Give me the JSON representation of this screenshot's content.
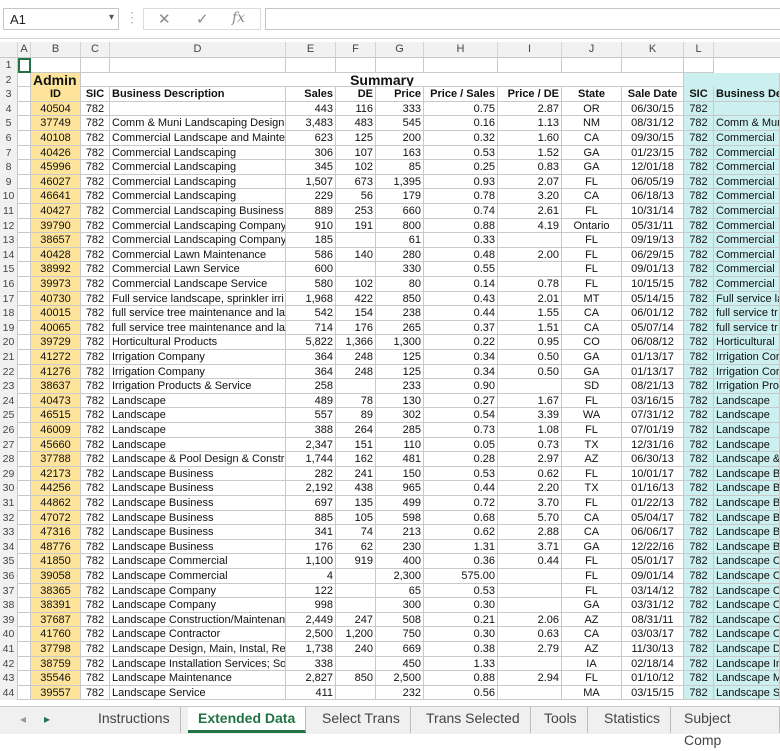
{
  "formula_bar": {
    "name_box": "A1",
    "fx": "fx",
    "cancel": "✕",
    "enter": "✓",
    "formula": ""
  },
  "columns": [
    "A",
    "B",
    "C",
    "D",
    "E",
    "F",
    "G",
    "H",
    "I",
    "J",
    "K",
    "L"
  ],
  "titles": {
    "admin": "Admin",
    "summary": "Summary"
  },
  "headers": [
    "ID",
    "SIC",
    "Business Description",
    "Sales",
    "DE",
    "Price",
    "Price / Sales",
    "Price / DE",
    "State",
    "Sale Date",
    "SIC",
    "Business De"
  ],
  "rows": [
    [
      "40504",
      "782",
      "",
      "443",
      "116",
      "333",
      "0.75",
      "2.87",
      "OR",
      "06/30/15",
      "782",
      ""
    ],
    [
      "37749",
      "782",
      "Comm & Muni Landscaping Design,",
      "3,483",
      "483",
      "545",
      "0.16",
      "1.13",
      "NM",
      "08/31/12",
      "782",
      "Comm & Mun"
    ],
    [
      "40108",
      "782",
      "Commercial Landscape and Mainte",
      "623",
      "125",
      "200",
      "0.32",
      "1.60",
      "CA",
      "09/30/15",
      "782",
      "Commercial"
    ],
    [
      "40426",
      "782",
      "Commercial Landscaping",
      "306",
      "107",
      "163",
      "0.53",
      "1.52",
      "GA",
      "01/23/15",
      "782",
      "Commercial"
    ],
    [
      "45996",
      "782",
      "Commercial Landscaping",
      "345",
      "102",
      "85",
      "0.25",
      "0.83",
      "GA",
      "12/01/18",
      "782",
      "Commercial"
    ],
    [
      "46027",
      "782",
      "Commercial Landscaping",
      "1,507",
      "673",
      "1,395",
      "0.93",
      "2.07",
      "FL",
      "06/05/19",
      "782",
      "Commercial"
    ],
    [
      "46641",
      "782",
      "Commercial Landscaping",
      "229",
      "56",
      "179",
      "0.78",
      "3.20",
      "CA",
      "06/18/13",
      "782",
      "Commercial"
    ],
    [
      "40427",
      "782",
      "Commercial Landscaping Business",
      "889",
      "253",
      "660",
      "0.74",
      "2.61",
      "FL",
      "10/31/14",
      "782",
      "Commercial"
    ],
    [
      "39790",
      "782",
      "Commercial Landscaping Company",
      "910",
      "191",
      "800",
      "0.88",
      "4.19",
      "Ontario",
      "05/31/11",
      "782",
      "Commercial"
    ],
    [
      "38657",
      "782",
      "Commercial Landscaping Company",
      "185",
      "",
      "61",
      "0.33",
      "",
      "FL",
      "09/19/13",
      "782",
      "Commercial"
    ],
    [
      "40428",
      "782",
      "Commercial Lawn Maintenance",
      "586",
      "140",
      "280",
      "0.48",
      "2.00",
      "FL",
      "06/29/15",
      "782",
      "Commercial"
    ],
    [
      "38992",
      "782",
      "Commercial Lawn Service",
      "600",
      "",
      "330",
      "0.55",
      "",
      "FL",
      "09/01/13",
      "782",
      "Commercial"
    ],
    [
      "39973",
      "782",
      "Commercial Landscape Service",
      "580",
      "102",
      "80",
      "0.14",
      "0.78",
      "FL",
      "10/15/15",
      "782",
      "Commercial"
    ],
    [
      "40730",
      "782",
      "Full service landscape, sprinkler irri",
      "1,968",
      "422",
      "850",
      "0.43",
      "2.01",
      "MT",
      "05/14/15",
      "782",
      "Full service la"
    ],
    [
      "40015",
      "782",
      "full service tree maintenance and la",
      "542",
      "154",
      "238",
      "0.44",
      "1.55",
      "CA",
      "06/01/12",
      "782",
      "full service tr"
    ],
    [
      "40065",
      "782",
      "full service tree maintenance and la",
      "714",
      "176",
      "265",
      "0.37",
      "1.51",
      "CA",
      "05/07/14",
      "782",
      "full service tr"
    ],
    [
      "39729",
      "782",
      "Horticultural Products",
      "5,822",
      "1,366",
      "1,300",
      "0.22",
      "0.95",
      "CO",
      "06/08/12",
      "782",
      "Horticultural"
    ],
    [
      "41272",
      "782",
      "Irrigation Company",
      "364",
      "248",
      "125",
      "0.34",
      "0.50",
      "GA",
      "01/13/17",
      "782",
      "Irrigation Cor"
    ],
    [
      "41276",
      "782",
      "Irrigation Company",
      "364",
      "248",
      "125",
      "0.34",
      "0.50",
      "GA",
      "01/13/17",
      "782",
      "Irrigation Cor"
    ],
    [
      "38637",
      "782",
      "Irrigation Products & Service",
      "258",
      "",
      "233",
      "0.90",
      "",
      "SD",
      "08/21/13",
      "782",
      "Irrigation Pro"
    ],
    [
      "40473",
      "782",
      "Landscape",
      "489",
      "78",
      "130",
      "0.27",
      "1.67",
      "FL",
      "03/16/15",
      "782",
      "Landscape"
    ],
    [
      "46515",
      "782",
      "Landscape",
      "557",
      "89",
      "302",
      "0.54",
      "3.39",
      "WA",
      "07/31/12",
      "782",
      "Landscape"
    ],
    [
      "46009",
      "782",
      "Landscape",
      "388",
      "264",
      "285",
      "0.73",
      "1.08",
      "FL",
      "07/01/19",
      "782",
      "Landscape"
    ],
    [
      "45660",
      "782",
      "Landscape",
      "2,347",
      "151",
      "110",
      "0.05",
      "0.73",
      "TX",
      "12/31/16",
      "782",
      "Landscape"
    ],
    [
      "37788",
      "782",
      "Landscape & Pool Design & Constru",
      "1,744",
      "162",
      "481",
      "0.28",
      "2.97",
      "AZ",
      "06/30/13",
      "782",
      "Landscape &"
    ],
    [
      "42173",
      "782",
      "Landscape Business",
      "282",
      "241",
      "150",
      "0.53",
      "0.62",
      "FL",
      "10/01/17",
      "782",
      "Landscape Bu"
    ],
    [
      "44256",
      "782",
      "Landscape Business",
      "2,192",
      "438",
      "965",
      "0.44",
      "2.20",
      "TX",
      "01/16/13",
      "782",
      "Landscape Bu"
    ],
    [
      "44862",
      "782",
      "Landscape Business",
      "697",
      "135",
      "499",
      "0.72",
      "3.70",
      "FL",
      "01/22/13",
      "782",
      "Landscape Bu"
    ],
    [
      "47072",
      "782",
      "Landscape Business",
      "885",
      "105",
      "598",
      "0.68",
      "5.70",
      "CA",
      "05/04/17",
      "782",
      "Landscape Bu"
    ],
    [
      "47316",
      "782",
      "Landscape Business",
      "341",
      "74",
      "213",
      "0.62",
      "2.88",
      "CA",
      "06/06/17",
      "782",
      "Landscape Bu"
    ],
    [
      "48776",
      "782",
      "Landscape Business",
      "176",
      "62",
      "230",
      "1.31",
      "3.71",
      "GA",
      "12/22/16",
      "782",
      "Landscape Bu"
    ],
    [
      "41850",
      "782",
      "Landscape Commercial",
      "1,100",
      "919",
      "400",
      "0.36",
      "0.44",
      "FL",
      "05/01/17",
      "782",
      "Landscape C"
    ],
    [
      "39058",
      "782",
      "Landscape Commercial",
      "4",
      "",
      "2,300",
      "575.00",
      "",
      "FL",
      "09/01/14",
      "782",
      "Landscape C"
    ],
    [
      "38365",
      "782",
      "Landscape Company",
      "122",
      "",
      "65",
      "0.53",
      "",
      "FL",
      "03/14/12",
      "782",
      "Landscape C"
    ],
    [
      "38391",
      "782",
      "Landscape Company",
      "998",
      "",
      "300",
      "0.30",
      "",
      "GA",
      "03/31/12",
      "782",
      "Landscape C"
    ],
    [
      "37687",
      "782",
      "Landscape Construction/Maintenan",
      "2,449",
      "247",
      "508",
      "0.21",
      "2.06",
      "AZ",
      "08/31/11",
      "782",
      "Landscape C"
    ],
    [
      "41760",
      "782",
      "Landscape Contractor",
      "2,500",
      "1,200",
      "750",
      "0.30",
      "0.63",
      "CA",
      "03/03/17",
      "782",
      "Landscape C"
    ],
    [
      "37798",
      "782",
      "Landscape Design, Main, Instal, Re",
      "1,738",
      "240",
      "669",
      "0.38",
      "2.79",
      "AZ",
      "11/30/13",
      "782",
      "Landscape D"
    ],
    [
      "38759",
      "782",
      "Landscape Installation Services; So",
      "338",
      "",
      "450",
      "1.33",
      "",
      "IA",
      "02/18/14",
      "782",
      "Landscape In"
    ],
    [
      "35546",
      "782",
      "Landscape Maintenance",
      "2,827",
      "850",
      "2,500",
      "0.88",
      "2.94",
      "FL",
      "01/10/12",
      "782",
      "Landscape M"
    ],
    [
      "39557",
      "782",
      "Landscape Service",
      "411",
      "",
      "232",
      "0.56",
      "",
      "MA",
      "03/15/15",
      "782",
      "Landscape S"
    ]
  ],
  "tabs": [
    "Instructions",
    "Extended Data",
    "Select Trans",
    "Trans Selected",
    "Tools",
    "Statistics",
    "Subject Comp"
  ],
  "active_tab": "Extended Data"
}
